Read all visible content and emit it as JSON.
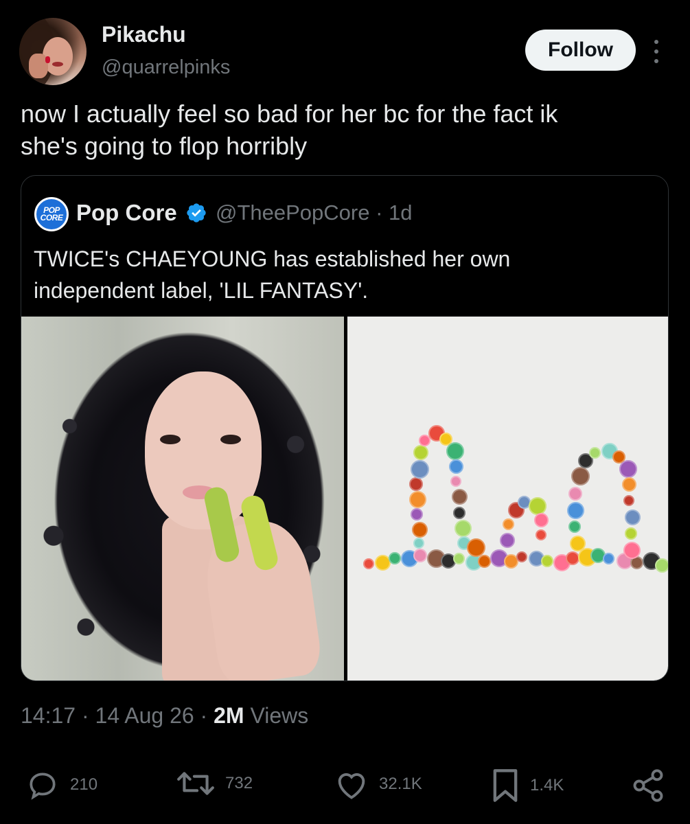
{
  "post": {
    "display_name": "Pikachu",
    "handle": "@quarrelpinks",
    "follow_label": "Follow",
    "text": "now I actually feel so bad for her bc for the fact ik\nshe's going to flop horribly"
  },
  "quote": {
    "logo_text_top": "POP",
    "logo_text_bottom": "CORE",
    "display_name": "Pop Core",
    "handle_time": "@TheePopCore · 1d",
    "text": "TWICE's CHAEYOUNG has established her own\nindependent label, 'LIL FANTASY'."
  },
  "meta": {
    "time": "14:17",
    "date": "14 Aug 26",
    "views_count": "2M",
    "views_label": "Views",
    "sep": " · "
  },
  "actions": {
    "replies": "210",
    "reposts": "732",
    "likes": "32.1K",
    "bookmarks": "1.4K"
  },
  "colors": {
    "background": "#000000",
    "text": "#e7e9ea",
    "muted": "#71767b",
    "verified": "#1d9bf0"
  }
}
